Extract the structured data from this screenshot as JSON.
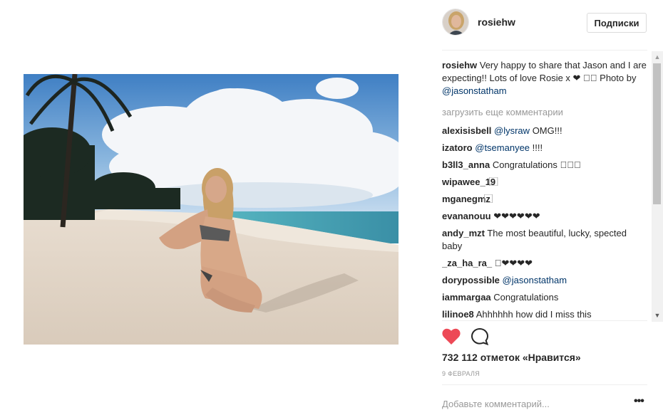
{
  "post": {
    "author": "rosiehw",
    "follow_label": "Подписки",
    "caption": {
      "user": "rosiehw",
      "text": "Very happy to share that Jason and I are expecting!! Lots of love Rosie x ❤ ⃞⃞ Photo by",
      "mention": "@jasonstatham"
    },
    "load_more": "загрузить еще комментарии",
    "comments": [
      {
        "user": "alexisisbell",
        "mention": "@lysraw",
        "text": "OMG!!!"
      },
      {
        "user": "izatoro",
        "mention": "@tsemanyee",
        "text": "!!!!"
      },
      {
        "user": "b3ll3_anna",
        "mention": "",
        "text": "Congratulations ⃞⃞⃞"
      },
      {
        "user": "wipawee_19",
        "mention": "",
        "text": "⃞⃞⃞⃞"
      },
      {
        "user": "mganegmz",
        "mention": "",
        "text": "⃞⃞⃞⃞⃞"
      },
      {
        "user": "evananouu",
        "mention": "",
        "text": "❤❤❤❤❤❤"
      },
      {
        "user": "andy_mzt",
        "mention": "",
        "text": "The most beautiful, lucky, spected baby"
      },
      {
        "user": "_za_ha_ra_",
        "mention": "",
        "text": "⃞❤❤❤❤"
      },
      {
        "user": "dorypossible",
        "mention": "@jasonstatham",
        "text": ""
      },
      {
        "user": "iammargaa",
        "mention": "",
        "text": "Congratulations"
      },
      {
        "user": "lilinoe8",
        "mention": "",
        "text": "Ahhhhhh how did I miss this"
      }
    ],
    "likes": "732 112 отметок «Нравится»",
    "date": "9 ФЕВРАЛЯ",
    "add_comment_placeholder": "Добавьте комментарий...",
    "icons": {
      "like": "heart-icon",
      "comment": "comment-icon",
      "more": "more-options-icon"
    },
    "colors": {
      "like_red": "#ed4956",
      "mention": "#003569",
      "muted": "#999999"
    }
  }
}
